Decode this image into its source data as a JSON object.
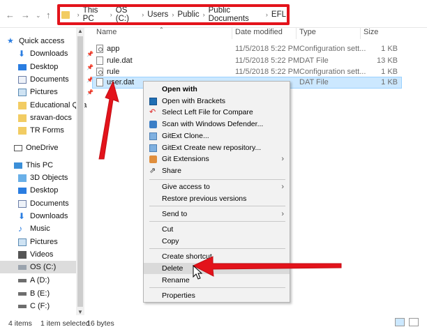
{
  "address": {
    "crumbs": [
      "This PC",
      "OS (C:)",
      "Users",
      "Public",
      "Public Documents",
      "EFL"
    ]
  },
  "nav": {
    "quick_access": "Quick access",
    "items": [
      {
        "label": "Downloads",
        "icon": "download-icon",
        "pinned": true
      },
      {
        "label": "Desktop",
        "icon": "desktop-icon",
        "pinned": true
      },
      {
        "label": "Documents",
        "icon": "documents-icon",
        "pinned": true
      },
      {
        "label": "Pictures",
        "icon": "pictures-icon",
        "pinned": true
      },
      {
        "label": "Educational Qua",
        "icon": "folder-icon",
        "pinned": false
      },
      {
        "label": "sravan-docs",
        "icon": "folder-icon",
        "pinned": false
      },
      {
        "label": "TR Forms",
        "icon": "folder-icon",
        "pinned": false
      }
    ],
    "onedrive": "OneDrive",
    "this_pc": "This PC",
    "pc_items": [
      {
        "label": "3D Objects",
        "icon": "3d-objects-icon"
      },
      {
        "label": "Desktop",
        "icon": "desktop-icon"
      },
      {
        "label": "Documents",
        "icon": "documents-icon"
      },
      {
        "label": "Downloads",
        "icon": "download-icon"
      },
      {
        "label": "Music",
        "icon": "music-icon"
      },
      {
        "label": "Pictures",
        "icon": "pictures-icon"
      },
      {
        "label": "Videos",
        "icon": "videos-icon"
      },
      {
        "label": "OS (C:)",
        "icon": "drive-icon"
      },
      {
        "label": "A (D:)",
        "icon": "drive-icon"
      },
      {
        "label": "B (E:)",
        "icon": "drive-icon"
      },
      {
        "label": "C (F:)",
        "icon": "drive-icon"
      }
    ]
  },
  "columns": {
    "name": "Name",
    "date": "Date modified",
    "type": "Type",
    "size": "Size"
  },
  "files": [
    {
      "name": "app",
      "date": "11/5/2018 5:22 PM",
      "type": "Configuration sett...",
      "size": "1 KB",
      "icon": "config-file-icon"
    },
    {
      "name": "rule.dat",
      "date": "11/5/2018 5:22 PM",
      "type": "DAT File",
      "size": "13 KB",
      "icon": "file-icon"
    },
    {
      "name": "rule",
      "date": "11/5/2018 5:22 PM",
      "type": "Configuration sett...",
      "size": "1 KB",
      "icon": "config-file-icon"
    },
    {
      "name": "user.dat",
      "date": "",
      "type": "DAT File",
      "size": "1 KB",
      "icon": "file-icon"
    }
  ],
  "context_menu": {
    "items": [
      {
        "label": "Open with",
        "bold": true
      },
      {
        "label": "Open with Brackets",
        "icon": "brackets-icon"
      },
      {
        "label": "Select Left File for Compare",
        "icon": "compare-icon"
      },
      {
        "label": "Scan with Windows Defender...",
        "icon": "defender-icon"
      },
      {
        "label": "GitExt Clone...",
        "icon": "gitext-icon"
      },
      {
        "label": "GitExt Create new repository...",
        "icon": "gitext-icon"
      },
      {
        "label": "Git Extensions",
        "icon": "git-extensions-icon",
        "submenu": true
      },
      {
        "label": "Share",
        "icon": "share-icon"
      },
      {
        "label": "Give access to",
        "submenu": true
      },
      {
        "label": "Restore previous versions"
      },
      {
        "label": "Send to",
        "submenu": true
      },
      {
        "label": "Cut"
      },
      {
        "label": "Copy"
      },
      {
        "label": "Create shortcut"
      },
      {
        "label": "Delete",
        "hover": true
      },
      {
        "label": "Rename"
      },
      {
        "label": "Properties"
      }
    ]
  },
  "status": {
    "count": "4 items",
    "selected": "1 item selected",
    "size": "16 bytes"
  },
  "colors": {
    "highlight_red": "#e3131b",
    "selection_blue": "#cce8ff"
  }
}
